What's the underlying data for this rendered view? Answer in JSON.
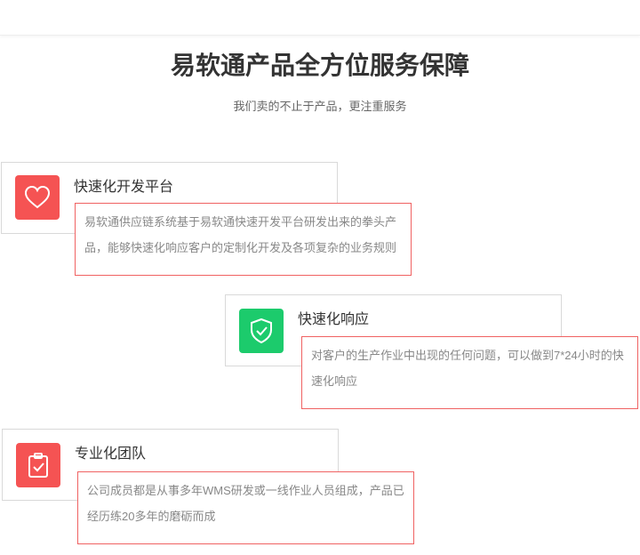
{
  "header": {
    "title": "易软通产品全方位服务保障",
    "subtitle": "我们卖的不止于产品，更注重服务"
  },
  "features": [
    {
      "title": "快速化开发平台",
      "icon": "heart-icon",
      "color": "#f55353",
      "description": "易软通供应链系统基于易软通快速开发平台研发出来的拳头产品，能够快速化响应客户的定制化开发及各项复杂的业务规则"
    },
    {
      "title": "快速化响应",
      "icon": "shield-check-icon",
      "color": "#1ccb6c",
      "description": "对客户的生产作业中出现的任何问题，可以做到7*24小时的快速化响应"
    },
    {
      "title": "专业化团队",
      "icon": "clipboard-check-icon",
      "color": "#f55353",
      "description": "公司成员都是从事多年WMS研发或一线作业人员组成，产品已经历练20多年的磨砺而成"
    }
  ]
}
